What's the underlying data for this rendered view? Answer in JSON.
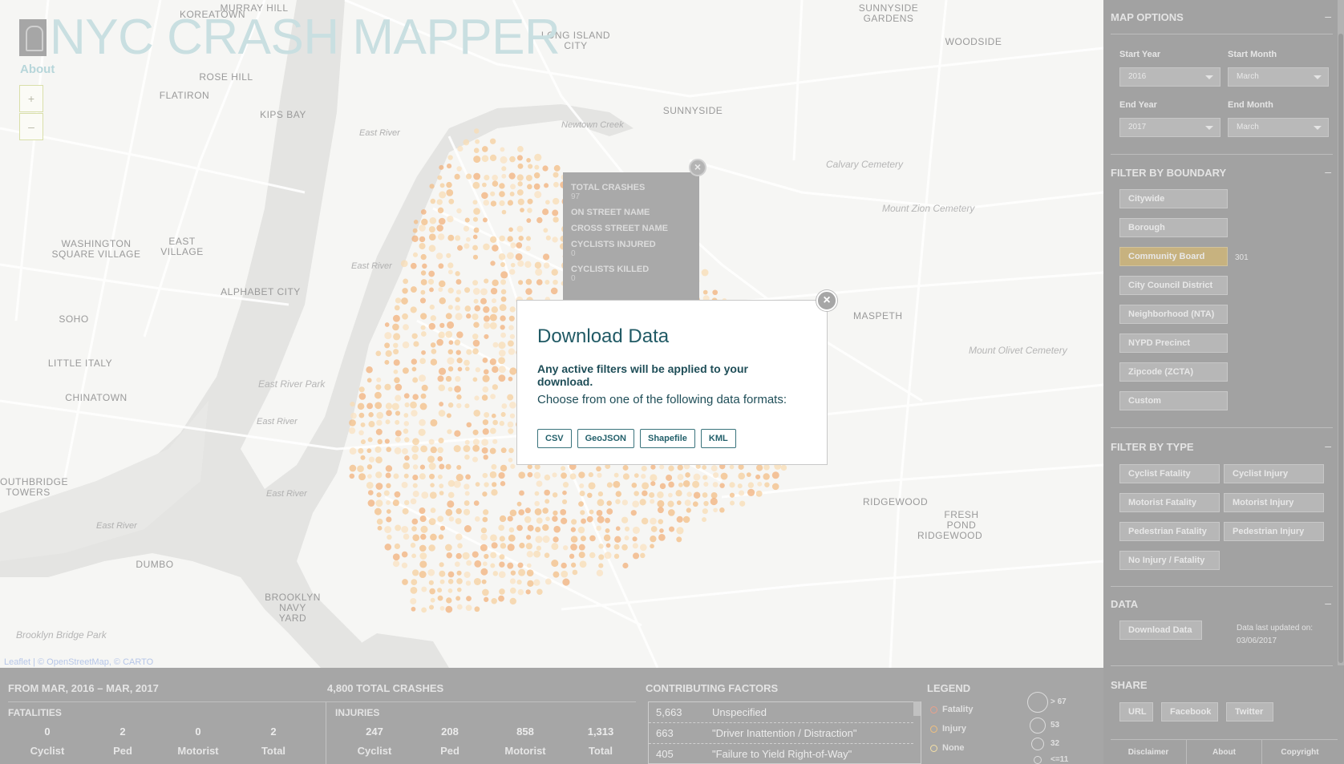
{
  "app": {
    "title": "NYC CRASH MAPPER",
    "about_label": "About",
    "zoom_in": "+",
    "zoom_out": "–",
    "attribution": "Leaflet | © OpenStreetMap, © CARTO"
  },
  "map_labels": {
    "places": [
      {
        "text": "MURRAY HILL"
      },
      {
        "text": "KOREATOWN"
      },
      {
        "text": "ROSE HILL"
      },
      {
        "text": "FLATIRON"
      },
      {
        "text": "KIPS BAY"
      },
      {
        "text": "LONG ISLAND CITY"
      },
      {
        "text": "SUNNYSIDE GARDENS"
      },
      {
        "text": "WOODSIDE"
      },
      {
        "text": "SUNNYSIDE"
      },
      {
        "text": "WASHINGTON SQUARE VILLAGE"
      },
      {
        "text": "EAST VILLAGE"
      },
      {
        "text": "ALPHABET CITY"
      },
      {
        "text": "SOHO"
      },
      {
        "text": "LITTLE ITALY"
      },
      {
        "text": "CHINATOWN"
      },
      {
        "text": "MASPETH"
      },
      {
        "text": "RIDGEWOOD"
      },
      {
        "text": "FRESH POND"
      },
      {
        "text": "RIDGEWOOD"
      },
      {
        "text": "DUMBO"
      },
      {
        "text": "BROOKLYN NAVY YARD"
      },
      {
        "text": "OUTHBRIDGE TOWERS"
      }
    ],
    "water": [
      {
        "text": "East River"
      },
      {
        "text": "East River"
      },
      {
        "text": "East River"
      },
      {
        "text": "East River"
      },
      {
        "text": "Newtown Creek"
      },
      {
        "text": "East River"
      }
    ],
    "parks": [
      {
        "text": "Calvary Cemetery"
      },
      {
        "text": "Mount Zion Cemetery"
      },
      {
        "text": "Mount Olivet Cemetery"
      },
      {
        "text": "East River Park"
      },
      {
        "text": "Brooklyn Bridge Park"
      }
    ]
  },
  "street_popup": {
    "total_crashes_label": "TOTAL CRASHES",
    "total_crashes_value": "97",
    "on_street_label": "ON STREET NAME",
    "cross_street_label": "CROSS STREET NAME",
    "cyclists_injured_label": "CYCLISTS INJURED",
    "cyclists_injured_value": "0",
    "cyclists_killed_label": "CYCLISTS KILLED",
    "cyclists_killed_value": "0"
  },
  "modal": {
    "title": "Download Data",
    "notice": "Any active filters will be applied to your download.",
    "choose": "Choose from one of the following data formats:",
    "formats": [
      "CSV",
      "GeoJSON",
      "Shapefile",
      "KML"
    ]
  },
  "sidebar": {
    "map_options": {
      "heading": "MAP OPTIONS",
      "toggle": "–",
      "start_year_label": "Start Year",
      "start_year": "2016",
      "start_month_label": "Start Month",
      "start_month": "March",
      "end_year_label": "End Year",
      "end_year": "2017",
      "end_month_label": "End Month",
      "end_month": "March"
    },
    "boundary": {
      "heading": "FILTER BY BOUNDARY",
      "toggle": "–",
      "items": [
        {
          "label": "Citywide",
          "active": false
        },
        {
          "label": "Borough",
          "active": false
        },
        {
          "label": "Community Board",
          "active": true
        },
        {
          "label": "City Council District",
          "active": false
        },
        {
          "label": "Neighborhood (NTA)",
          "active": false
        },
        {
          "label": "NYPD Precinct",
          "active": false
        },
        {
          "label": "Zipcode (ZCTA)",
          "active": false
        },
        {
          "label": "Custom",
          "active": false
        }
      ],
      "selected_value": "301"
    },
    "type": {
      "heading": "FILTER BY TYPE",
      "toggle": "–",
      "items": [
        "Cyclist Fatality",
        "Cyclist Injury",
        "Motorist Fatality",
        "Motorist Injury",
        "Pedestrian Fatality",
        "Pedestrian Injury",
        "No Injury / Fatality"
      ]
    },
    "data": {
      "heading": "DATA",
      "toggle": "–",
      "download_label": "Download Data",
      "updated_label": "Data last updated on:",
      "updated_date": "03/06/2017"
    },
    "share": {
      "heading": "SHARE",
      "items": [
        "URL",
        "Facebook",
        "Twitter"
      ]
    },
    "footer": [
      "Disclaimer",
      "About",
      "Copyright"
    ]
  },
  "stats": {
    "date_range": "FROM MAR, 2016 – MAR, 2017",
    "total_crashes": "4,800 TOTAL CRASHES",
    "fatalities": {
      "heading": "FATALITIES",
      "values": [
        "0",
        "2",
        "0",
        "2"
      ],
      "captions": [
        "Cyclist",
        "Ped",
        "Motorist",
        "Total"
      ]
    },
    "injuries": {
      "heading": "INJURIES",
      "values": [
        "247",
        "208",
        "858",
        "1,313"
      ],
      "captions": [
        "Cyclist",
        "Ped",
        "Motorist",
        "Total"
      ]
    },
    "factors": {
      "heading": "CONTRIBUTING FACTORS",
      "rows": [
        {
          "count": "5,663",
          "name": "Unspecified"
        },
        {
          "count": "663",
          "name": "\"Driver Inattention / Distraction\""
        },
        {
          "count": "405",
          "name": "\"Failure to Yield Right-of-Way\""
        }
      ]
    },
    "legend": {
      "heading": "LEGEND",
      "types": [
        {
          "label": "Fatality",
          "color": "#e9a08b"
        },
        {
          "label": "Injury",
          "color": "#f1c07e"
        },
        {
          "label": "None",
          "color": "#f5e0a6"
        }
      ],
      "sizes": [
        "> 67",
        "53",
        "32",
        "<=11"
      ]
    }
  }
}
